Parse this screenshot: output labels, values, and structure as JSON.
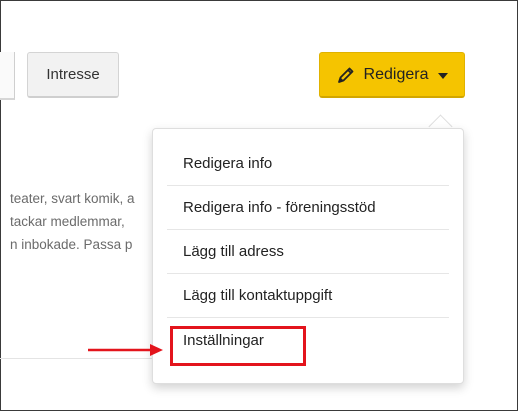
{
  "toolbar": {
    "intresse_label": "Intresse",
    "redigera_label": "Redigera",
    "redigera_color": "#f5c400"
  },
  "background_text": {
    "line1": "teater, svart komik, a",
    "line2": "tackar medlemmar, ",
    "line3": "n inbokade. Passa p"
  },
  "dropdown": {
    "items": [
      {
        "label": "Redigera info"
      },
      {
        "label": "Redigera info - föreningsstöd"
      },
      {
        "label": "Lägg till adress"
      },
      {
        "label": "Lägg till kontaktuppgift"
      },
      {
        "label": "Inställningar"
      }
    ]
  },
  "annotation": {
    "highlight_color": "#e3141c",
    "highlighted_item": "Inställningar",
    "arrow_icon": "right-arrow-icon"
  }
}
